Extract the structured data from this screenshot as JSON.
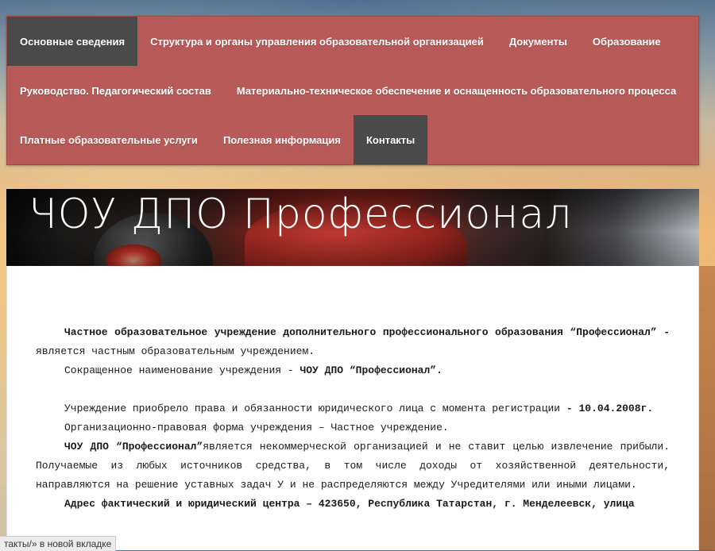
{
  "nav": {
    "rows": [
      [
        {
          "label": "Основные сведения",
          "active": true
        },
        {
          "label": "Структура и органы управления образовательной организацией",
          "active": false
        },
        {
          "label": "Документы",
          "active": false
        },
        {
          "label": "Образование",
          "active": false
        }
      ],
      [
        {
          "label": "Руководство. Педагогический состав",
          "active": false
        },
        {
          "label": "Материально-техническое обеспечение и оснащенность образовательного процесса",
          "active": false
        }
      ],
      [
        {
          "label": "Платные образовательные услуги",
          "active": false
        },
        {
          "label": "Полезная информация",
          "active": false
        },
        {
          "label": "Контакты",
          "active": true
        }
      ]
    ]
  },
  "header": {
    "title": "ЧОУ ДПО Профессионал"
  },
  "content": {
    "paragraphs": [
      {
        "gap": false,
        "runs": [
          {
            "b": true,
            "t": "Частное образовательное учреждение дополнительного профессионального образования “Профессионал” -"
          },
          {
            "b": false,
            "t": " является частным образовательным учреждением."
          }
        ]
      },
      {
        "gap": false,
        "runs": [
          {
            "b": false,
            "t": "Сокращенное наименование учреждения - "
          },
          {
            "b": true,
            "t": "ЧОУ ДПО “Профессионал”."
          }
        ]
      },
      {
        "gap": true,
        "runs": [
          {
            "b": false,
            "t": "Учреждение приобрело права и обязанности юридического лица с момента регистрации "
          },
          {
            "b": true,
            "t": "- 10.04.2008г."
          }
        ]
      },
      {
        "gap": false,
        "runs": [
          {
            "b": false,
            "t": "Организационно-правовая форма учреждения – Частное учреждение."
          }
        ]
      },
      {
        "gap": false,
        "runs": [
          {
            "b": true,
            "t": "ЧОУ ДПО “Профессионал”"
          },
          {
            "b": false,
            "t": "является некоммерческой организацией и не ставит целью извлечение прибыли. Получаемые из любых источников средства, в том числе доходы от хозяйственной деятельности, направляются на решение уставных задач У и не распределяются между Учредителями или иными лицами."
          }
        ]
      },
      {
        "gap": false,
        "runs": [
          {
            "b": true,
            "t": "Адрес фактический и юридический центра – 423650, Республика Татарстан, г. Менделеевск, улица"
          }
        ]
      }
    ]
  },
  "statusbar": {
    "text": "такты/» в новой вкладке"
  }
}
